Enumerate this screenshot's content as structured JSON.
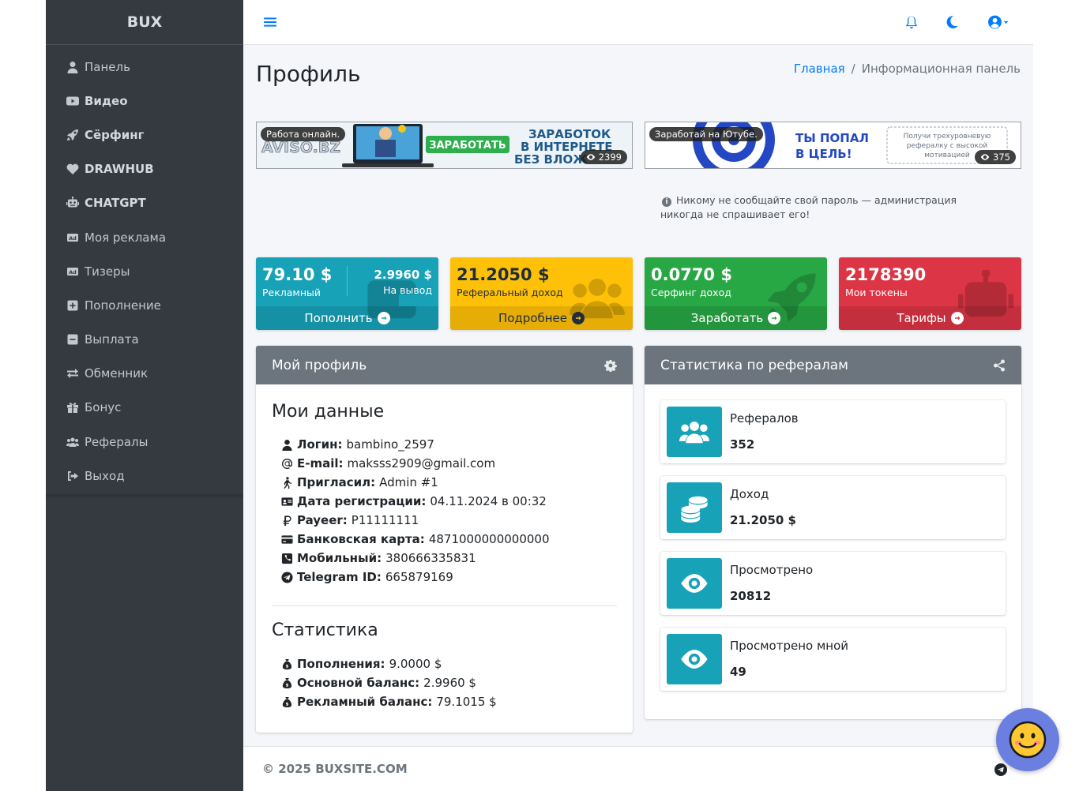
{
  "sidebar": {
    "brand": "BUX",
    "items": [
      {
        "label": "Панель",
        "icon": "user-icon"
      },
      {
        "label": "Видео",
        "icon": "youtube-icon"
      },
      {
        "label": "Сёрфинг",
        "icon": "rocket-icon"
      },
      {
        "label": "DRAWHUB",
        "icon": "heart-icon"
      },
      {
        "label": "CHATGPT",
        "icon": "robot-icon"
      },
      {
        "label": "Моя реклама",
        "icon": "ad-icon"
      },
      {
        "label": "Тизеры",
        "icon": "ad-icon"
      },
      {
        "label": "Пополнение",
        "icon": "plus-square-icon"
      },
      {
        "label": "Выплата",
        "icon": "minus-square-icon"
      },
      {
        "label": "Обменник",
        "icon": "exchange-icon"
      },
      {
        "label": "Бонус",
        "icon": "gift-icon"
      },
      {
        "label": "Рефералы",
        "icon": "users-icon"
      },
      {
        "label": "Выход",
        "icon": "sign-out-icon"
      }
    ]
  },
  "header": {
    "title": "Профиль",
    "breadcrumb": {
      "home": "Главная",
      "separator": "/",
      "current": "Информационная панель"
    }
  },
  "banners": [
    {
      "tag": "Работа онлайн.",
      "views": "2399"
    },
    {
      "tag": "Заработай на Ютубе.",
      "views": "375"
    }
  ],
  "notice": "Никому не сообщайте свой пароль — администрация никогда не спрашивает его!",
  "stats_boxes": {
    "ad": {
      "value": "79.10 $",
      "label": "Рекламный",
      "value2": "2.9960 $",
      "label2": "На вывод",
      "action": "Пополнить",
      "color": "#17a2b8"
    },
    "ref": {
      "value": "21.2050 $",
      "label": "Реферальный доход",
      "action": "Подробнее",
      "color": "#ffc107"
    },
    "surf": {
      "value": "0.0770 $",
      "label": "Серфинг доход",
      "action": "Заработать",
      "color": "#28a745"
    },
    "tokens": {
      "value": "2178390",
      "label": "Мои токены",
      "action": "Тарифы",
      "color": "#dc3545"
    }
  },
  "profile": {
    "card_title": "Мой профиль",
    "section_title": "Мои данные",
    "rows": [
      {
        "label": "Логин:",
        "value": "bambino_2597"
      },
      {
        "label": "E-mail:",
        "value": "maksss2909@gmail.com"
      },
      {
        "label": "Пригласил:",
        "value": "Admin #1"
      },
      {
        "label": "Дата регистрации:",
        "value": "04.11.2024 в 00:32"
      },
      {
        "label": "Payeer:",
        "value": "P11111111"
      },
      {
        "label": "Банковская карта:",
        "value": "4871000000000000"
      },
      {
        "label": "Мобильный:",
        "value": "380666335831"
      },
      {
        "label": "Telegram ID:",
        "value": "665879169"
      }
    ],
    "stats_title": "Статистика",
    "stats_rows": [
      {
        "label": "Пополнения:",
        "value": "9.0000 $"
      },
      {
        "label": "Основной баланс:",
        "value": "2.9960 $"
      },
      {
        "label": "Рекламный баланс:",
        "value": "79.1015 $"
      }
    ]
  },
  "referrals": {
    "card_title": "Статистика по рефералам",
    "items": [
      {
        "label": "Рефералов",
        "value": "352"
      },
      {
        "label": "Доход",
        "value": "21.2050 $"
      },
      {
        "label": "Просмотрено",
        "value": "20812"
      },
      {
        "label": "Просмотрено мной",
        "value": "49"
      }
    ]
  },
  "footer": {
    "copyright": "© 2025 BUXSITE.COM"
  }
}
